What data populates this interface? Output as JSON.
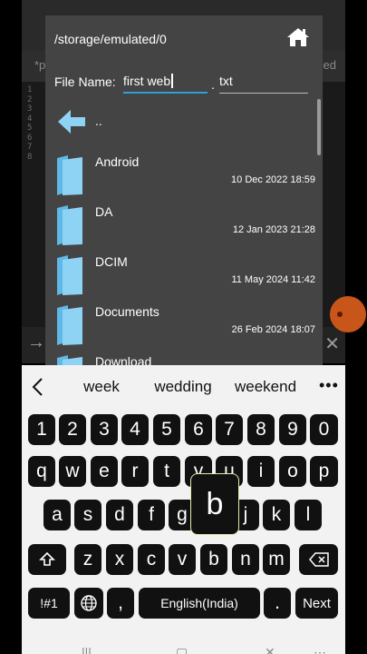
{
  "background_app": {
    "tab_left": "*p",
    "tab_right": "ed",
    "line_numbers": [
      "1",
      "2",
      "3",
      "4",
      "5",
      "6",
      "7",
      "8"
    ]
  },
  "dialog": {
    "path": "/storage/emulated/0",
    "home_icon": "home-icon",
    "file_name_label": "File Name:",
    "file_name_value": "first web",
    "ext_separator": ".",
    "extension_value": "txt",
    "up_label": "..",
    "items": [
      {
        "name": "Android",
        "date": "10 Dec 2022 18:59"
      },
      {
        "name": "DA",
        "date": "12 Jan 2023 21:28"
      },
      {
        "name": "DCIM",
        "date": "11 May 2024 11:42"
      },
      {
        "name": "Documents",
        "date": "26 Feb 2024 18:07"
      },
      {
        "name": "Download",
        "date": ""
      }
    ]
  },
  "keyboard": {
    "suggestions": [
      "week",
      "wedding",
      "weekend"
    ],
    "more_label": "•••",
    "number_row": [
      "1",
      "2",
      "3",
      "4",
      "5",
      "6",
      "7",
      "8",
      "9",
      "0"
    ],
    "row1": [
      "q",
      "w",
      "e",
      "r",
      "t",
      "y",
      "u",
      "i",
      "o",
      "p"
    ],
    "row2": [
      "a",
      "s",
      "d",
      "f",
      "g",
      "h",
      "j",
      "k",
      "l"
    ],
    "row3": [
      "z",
      "x",
      "c",
      "v",
      "b",
      "n",
      "m"
    ],
    "symbols_label": "!#1",
    "comma_label": ",",
    "space_label": "English(India)",
    "period_label": ".",
    "next_label": "Next",
    "popup_key": "b"
  },
  "colors": {
    "accent": "#2aa4d8",
    "folder": "#8fd3f4",
    "dialog_bg": "#444444",
    "key_bg": "#111111",
    "keyboard_bg": "#f2f2f2"
  }
}
